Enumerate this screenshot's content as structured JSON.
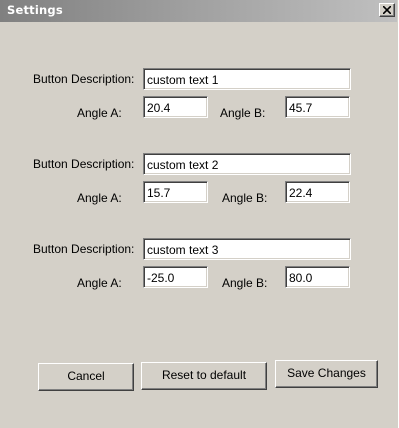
{
  "window": {
    "title": "Settings"
  },
  "labels": {
    "description": "Button Description:",
    "angle_a": "Angle A:",
    "angle_b": "Angle B:"
  },
  "groups": [
    {
      "description": "custom text 1",
      "angle_a": "20.4",
      "angle_b": "45.7"
    },
    {
      "description": "custom text 2",
      "angle_a": "15.7",
      "angle_b": "22.4"
    },
    {
      "description": "custom text 3",
      "angle_a": "-25.0",
      "angle_b": "80.0"
    }
  ],
  "buttons": {
    "cancel": "Cancel",
    "reset": "Reset to default",
    "save": "Save Changes"
  },
  "colors": {
    "dialog_bg": "#d4d0c8",
    "titlebar_start": "#808080",
    "titlebar_end": "#c0c0c0",
    "field_bg": "#ffffff"
  },
  "icons": {
    "close": "close-icon"
  }
}
